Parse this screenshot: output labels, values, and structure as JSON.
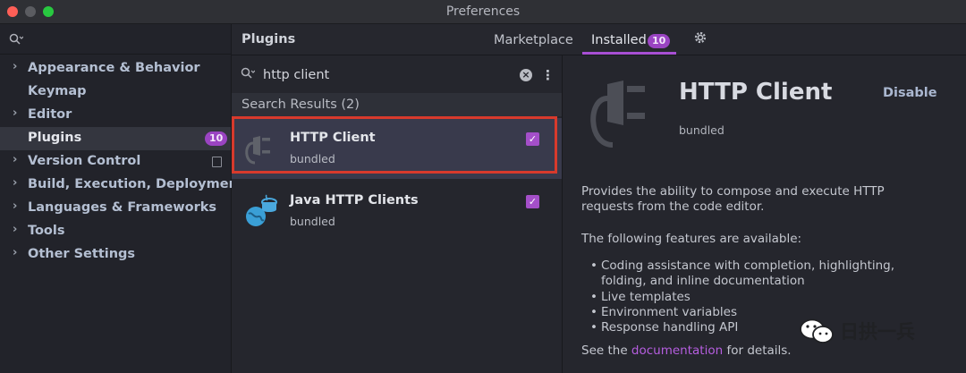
{
  "window": {
    "title": "Preferences"
  },
  "sidebar": {
    "search_placeholder": "",
    "items": [
      {
        "label": "Appearance & Behavior",
        "expandable": true
      },
      {
        "label": "Keymap",
        "expandable": false
      },
      {
        "label": "Editor",
        "expandable": true
      },
      {
        "label": "Plugins",
        "expandable": false,
        "selected": true,
        "badge": "10"
      },
      {
        "label": "Version Control",
        "expandable": true
      },
      {
        "label": "Build, Execution, Deployment",
        "expandable": true
      },
      {
        "label": "Languages & Frameworks",
        "expandable": true
      },
      {
        "label": "Tools",
        "expandable": true
      },
      {
        "label": "Other Settings",
        "expandable": true
      }
    ]
  },
  "plugins": {
    "title": "Plugins",
    "tabs": {
      "marketplace": "Marketplace",
      "installed": "Installed",
      "installed_badge": "10"
    },
    "search": {
      "value": "http client"
    },
    "results_header": "Search Results (2)",
    "results": [
      {
        "name": "HTTP Client",
        "sub": "bundled",
        "enabled": true,
        "selected": true
      },
      {
        "name": "Java HTTP Clients",
        "sub": "bundled",
        "enabled": true,
        "selected": false
      }
    ]
  },
  "detail": {
    "title": "HTTP Client",
    "action": "Disable",
    "bundled": "bundled",
    "description_1": "Provides the ability to compose and execute HTTP",
    "description_2": "requests from the code editor.",
    "features_intro": "The following features are available:",
    "features": [
      "Coding assistance with completion, highlighting,",
      "folding, and inline documentation",
      "Live templates",
      "Environment variables",
      "Response handling API"
    ],
    "see_prefix": "See the ",
    "see_link": "documentation",
    "see_suffix": " for details."
  },
  "watermark": {
    "text": "日拱一兵"
  },
  "colors": {
    "accent": "#a84fd4",
    "highlight_border": "#d83a2c",
    "link": "#b65ee0"
  }
}
